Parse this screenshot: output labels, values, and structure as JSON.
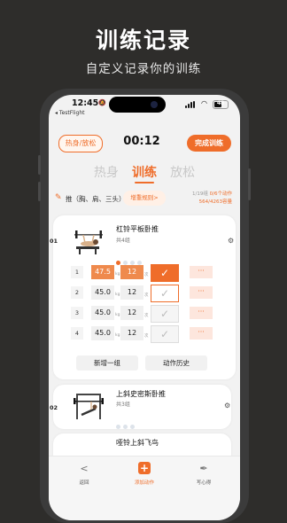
{
  "promo": {
    "title": "训练记录",
    "subtitle": "自定义记录你的训练"
  },
  "status_bar": {
    "time": "12:45",
    "battery": "48",
    "testflight": "◂ TestFlight"
  },
  "header": {
    "warmup_button": "热身/放松",
    "timer": "00:12",
    "finish_button": "完成训练"
  },
  "phase_tabs": [
    "热身",
    "训练",
    "放松"
  ],
  "muscle_group": {
    "label": "推（胸、肩、三头）",
    "increase_button": "增重规则>",
    "set_progress": "1/19组",
    "action_progress": "0/6个动作",
    "volume": "564/4263容量"
  },
  "exercises": [
    {
      "num": "01",
      "name": "杠铃平板卧推",
      "sets_label": "共4组",
      "sets": [
        {
          "num": "1",
          "weight": "47.5",
          "weight_unit": "kg",
          "reps": "12",
          "reps_unit": "次",
          "done": true
        },
        {
          "num": "2",
          "weight": "45.0",
          "weight_unit": "kg",
          "reps": "12",
          "reps_unit": "次",
          "done": false
        },
        {
          "num": "3",
          "weight": "45.0",
          "weight_unit": "kg",
          "reps": "12",
          "reps_unit": "次",
          "done": false
        },
        {
          "num": "4",
          "weight": "45.0",
          "weight_unit": "kg",
          "reps": "12",
          "reps_unit": "次",
          "done": false
        }
      ],
      "add_set_button": "新增一组",
      "history_button": "动作历史"
    },
    {
      "num": "02",
      "name": "上斜史密斯卧推",
      "sets_label": "共3组"
    },
    {
      "num": "03",
      "name": "哑铃上斜飞鸟"
    }
  ],
  "check_glyph": "✓",
  "more_glyph": "···",
  "bottom_nav": [
    {
      "label": "返回",
      "icon": "back-chevron-icon"
    },
    {
      "label": "添加动作",
      "icon": "add-square-icon"
    },
    {
      "label": "写心得",
      "icon": "feather-icon"
    }
  ],
  "colors": {
    "accent": "#ef6d2a",
    "background": "#2e2d2b"
  }
}
